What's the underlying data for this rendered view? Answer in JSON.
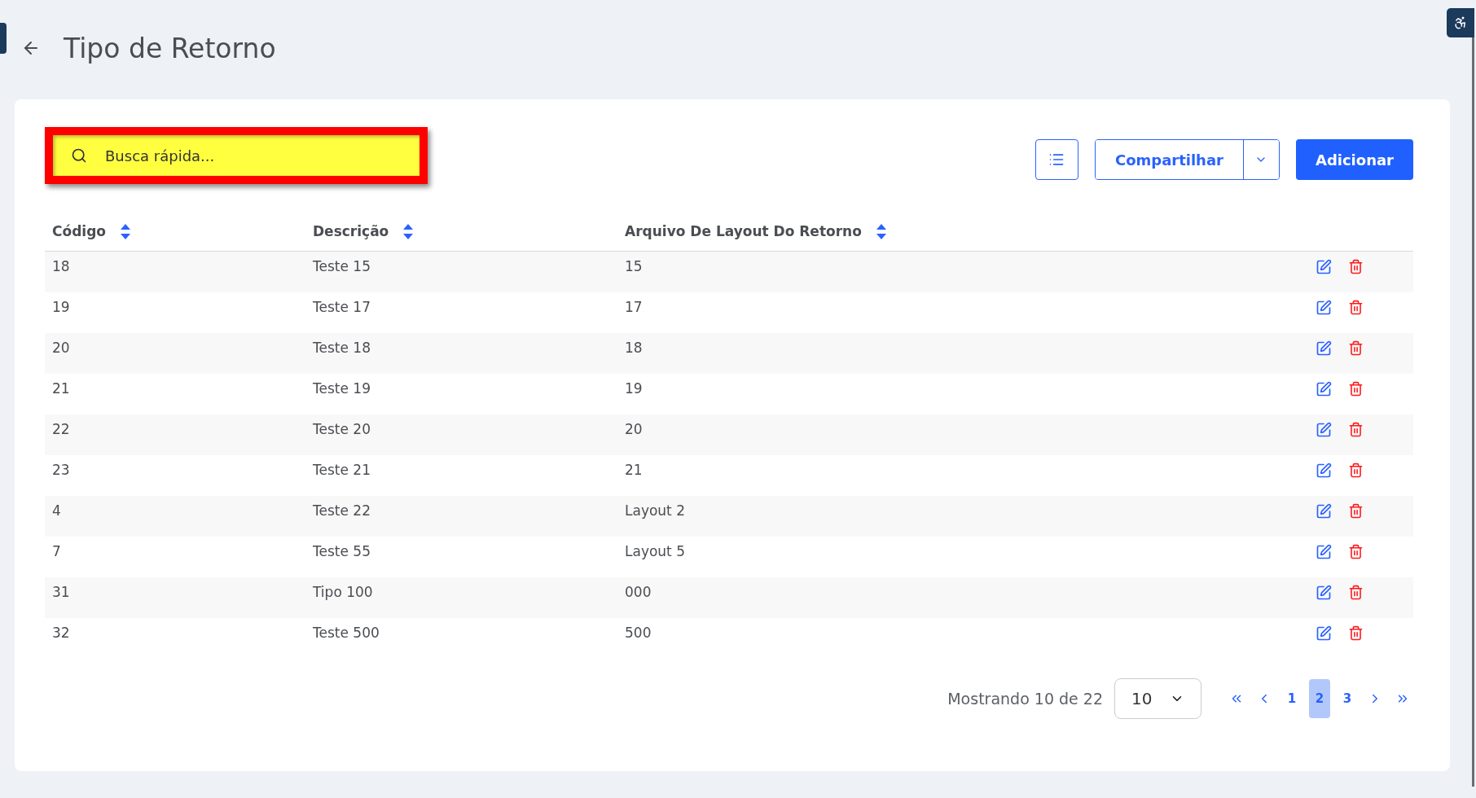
{
  "page": {
    "title": "Tipo de Retorno"
  },
  "search": {
    "placeholder": "Busca rápida..."
  },
  "toolbar": {
    "share_label": "Compartilhar",
    "add_label": "Adicionar"
  },
  "table": {
    "columns": [
      {
        "label": "Código",
        "sortable": true
      },
      {
        "label": "Descrição",
        "sortable": true
      },
      {
        "label": "Arquivo De Layout Do Retorno",
        "sortable": true
      }
    ],
    "rows": [
      {
        "cells": [
          "18",
          "Teste 15",
          "15"
        ]
      },
      {
        "cells": [
          "19",
          "Teste 17",
          "17"
        ]
      },
      {
        "cells": [
          "20",
          "Teste 18",
          "18"
        ]
      },
      {
        "cells": [
          "21",
          "Teste 19",
          "19"
        ]
      },
      {
        "cells": [
          "22",
          "Teste 20",
          "20"
        ]
      },
      {
        "cells": [
          "23",
          "Teste 21",
          "21"
        ]
      },
      {
        "cells": [
          "4",
          "Teste 22",
          "Layout 2"
        ]
      },
      {
        "cells": [
          "7",
          "Teste 55",
          "Layout 5"
        ]
      },
      {
        "cells": [
          "31",
          "Tipo 100",
          "000"
        ]
      },
      {
        "cells": [
          "32",
          "Teste 500",
          "500"
        ]
      }
    ]
  },
  "pagination": {
    "summary": "Mostrando 10 de 22",
    "page_size": "10",
    "pages": [
      {
        "label": "1",
        "selected": false
      },
      {
        "label": "2",
        "selected": true
      },
      {
        "label": "3",
        "selected": false
      }
    ]
  }
}
